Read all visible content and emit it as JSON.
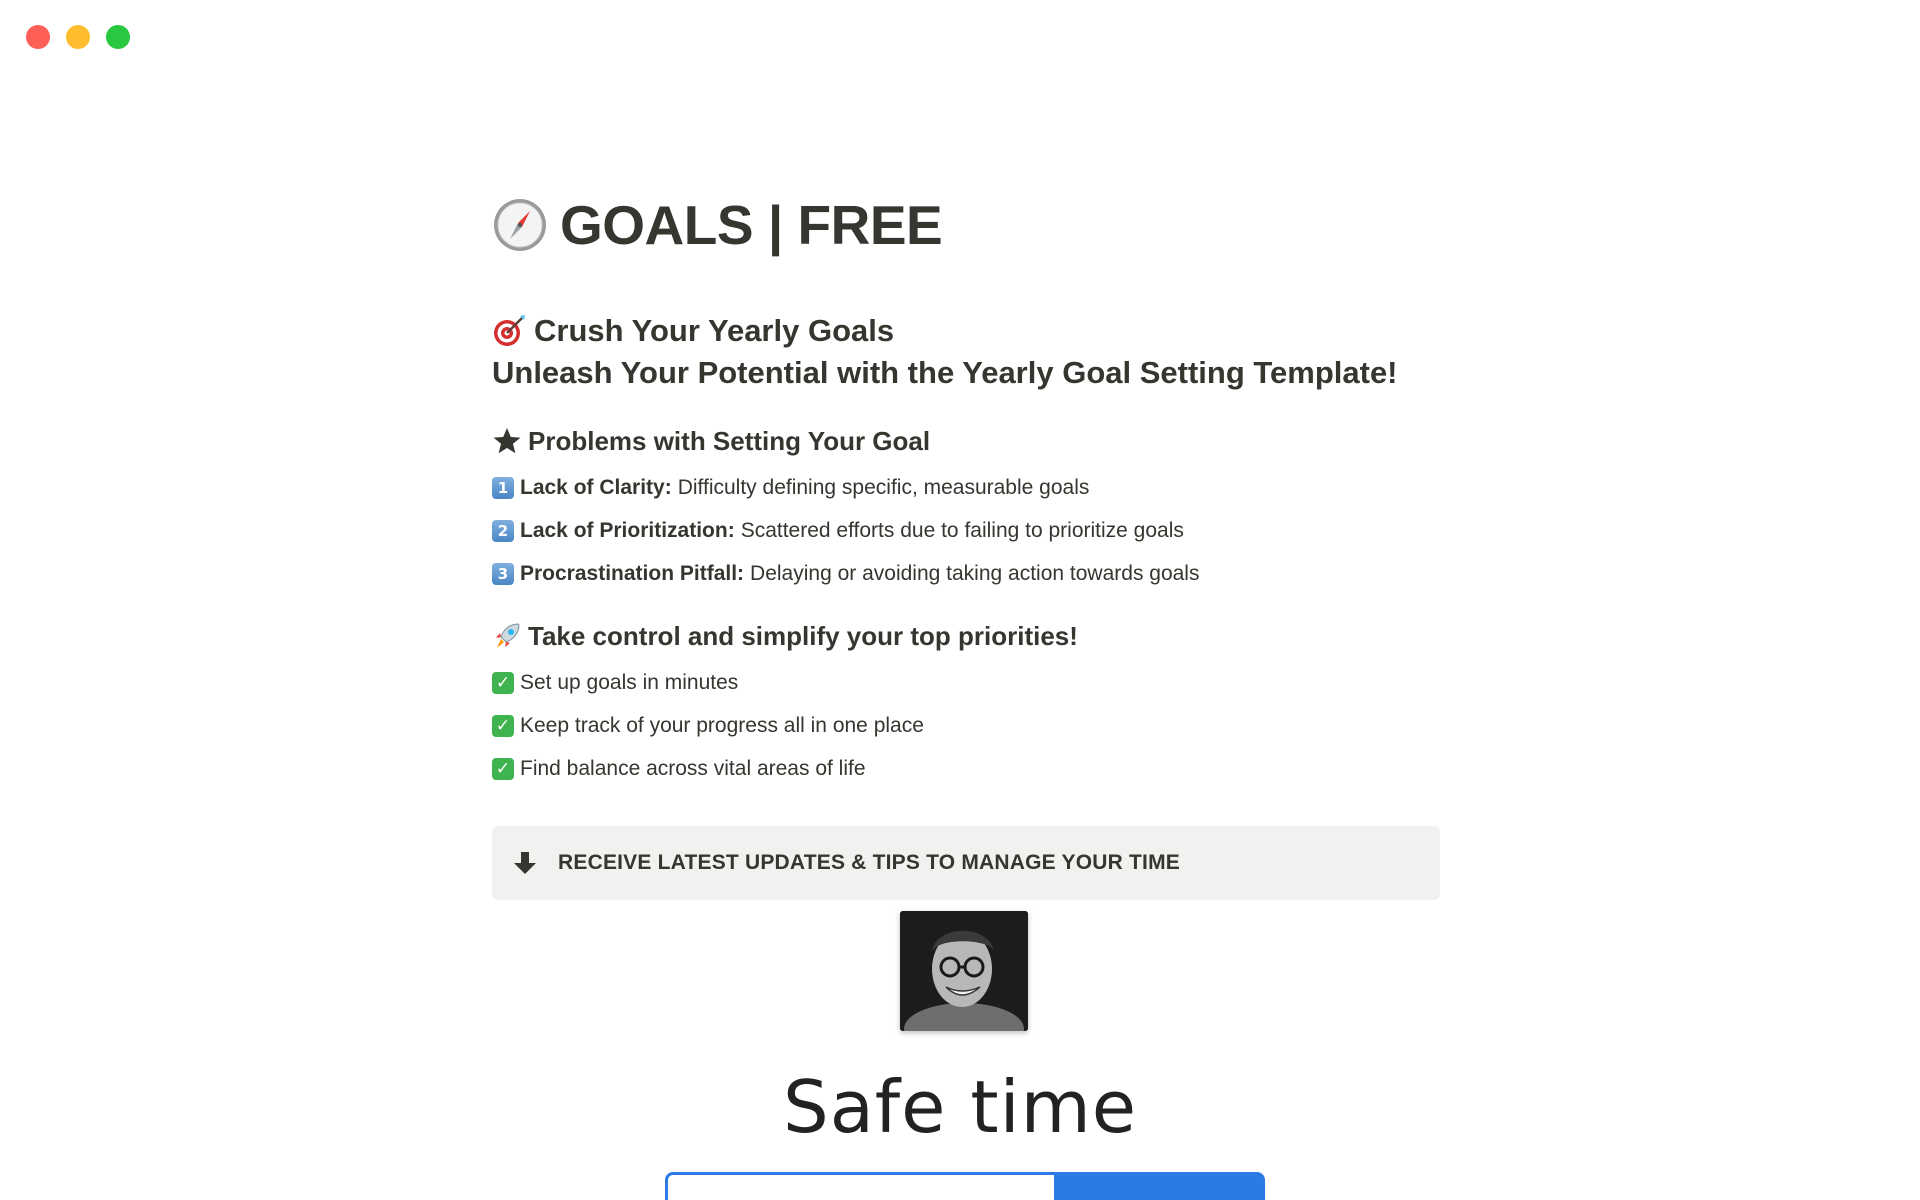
{
  "page": {
    "title": "GOALS | FREE",
    "title_icon": "compass-icon"
  },
  "intro": {
    "line1": "Crush Your Yearly Goals",
    "line1_icon": "dart-target-icon",
    "line2": "Unleash Your Potential with the Yearly Goal Setting Template!"
  },
  "problems": {
    "heading": "Problems with Setting Your Goal",
    "heading_icon": "star-icon",
    "items": [
      {
        "number": "1",
        "label": "Lack of Clarity:",
        "text": "Difficulty defining specific, measurable goals"
      },
      {
        "number": "2",
        "label": "Lack of Prioritization:",
        "text": "Scattered efforts due to failing to prioritize goals"
      },
      {
        "number": "3",
        "label": "Procrastination Pitfall:",
        "text": "Delaying or avoiding taking action towards goals"
      }
    ]
  },
  "benefits": {
    "heading": "Take control and simplify your top priorities!",
    "heading_icon": "rocket-icon",
    "items": [
      {
        "icon": "check-icon",
        "text": "Set up goals in minutes"
      },
      {
        "icon": "check-icon",
        "text": "Keep track of your progress all in one place"
      },
      {
        "icon": "check-icon",
        "text": "Find balance across vital areas of life"
      }
    ]
  },
  "callout": {
    "icon": "arrow-down-icon",
    "text": "RECEIVE LATEST UPDATES & TIPS TO MANAGE YOUR TIME"
  },
  "brand": {
    "name": "Safe time"
  },
  "colors": {
    "traffic_red": "#fe5f57",
    "traffic_yellow": "#febc2e",
    "traffic_green": "#28c840",
    "callout_bg": "#f1f1ef",
    "accent_blue": "#2c7be5",
    "text": "#37352f"
  }
}
